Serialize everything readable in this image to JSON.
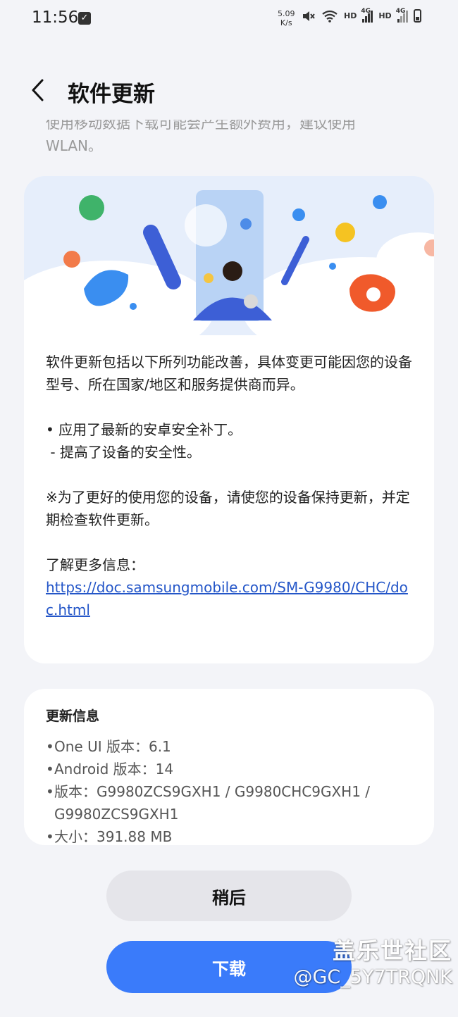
{
  "status_bar": {
    "time": "11:56",
    "speed_value": "5.09",
    "speed_unit": "K/s",
    "hd1": "HD",
    "net1": "4G",
    "hd2": "HD",
    "net2": "4G"
  },
  "header": {
    "title": "软件更新",
    "back_icon": "chevron-left-icon"
  },
  "faded_text": {
    "line1": "使用移动数据下载可能会产生额外费用，建议使用",
    "line2": "WLAN。"
  },
  "description": {
    "intro": "软件更新包括以下所列功能改善，具体变更可能因您的设备型号、所在国家/地区和服务提供商而异。",
    "bullet1": "• 应用了最新的安卓安全补丁。",
    "sub1": " - 提高了设备的安全性。",
    "note": "※为了更好的使用您的设备，请使您的设备保持更新，并定期检查软件更新。",
    "more_label": "了解更多信息：",
    "link": "https://doc.samsungmobile.com/SM-G9980/CHC/doc.html"
  },
  "update_info": {
    "title": "更新信息",
    "items": [
      "One UI 版本：6.1",
      "Android 版本：14",
      "版本：G9980ZCS9GXH1 / G9980CHC9GXH1 / G9980ZCS9GXH1",
      "大小：391.88 MB"
    ]
  },
  "buttons": {
    "later": "稍后",
    "download": "下载"
  },
  "watermark": {
    "line1": "盖乐世社区",
    "line2": "@GC_5Y7TRQNK"
  },
  "colors": {
    "background": "#f3f4f8",
    "card": "#ffffff",
    "link": "#2456c8",
    "primary_button": "#3a7bfa",
    "secondary_button": "#e5e5ea"
  }
}
